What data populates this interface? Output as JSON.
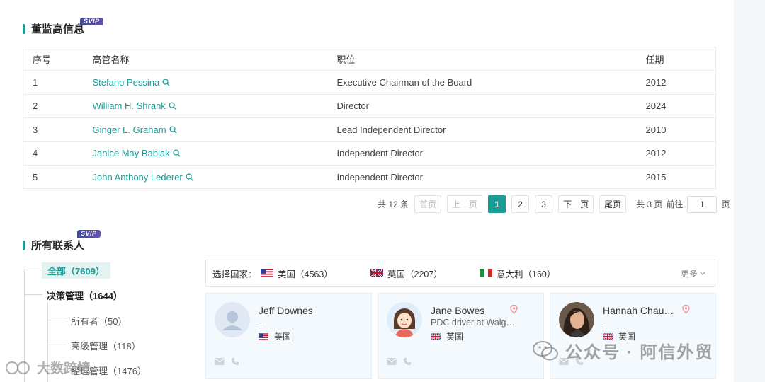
{
  "exec_section": {
    "title": "董监高信息",
    "badge": "SVIP",
    "columns": [
      "序号",
      "高管名称",
      "职位",
      "任期"
    ],
    "rows": [
      {
        "no": "1",
        "name": "Stefano Pessina",
        "position": "Executive Chairman of the Board",
        "term": "2012"
      },
      {
        "no": "2",
        "name": "William H. Shrank",
        "position": "Director",
        "term": "2024"
      },
      {
        "no": "3",
        "name": "Ginger L. Graham",
        "position": "Lead Independent Director",
        "term": "2010"
      },
      {
        "no": "4",
        "name": "Janice May Babiak",
        "position": "Independent Director",
        "term": "2012"
      },
      {
        "no": "5",
        "name": "John Anthony Lederer",
        "position": "Independent Director",
        "term": "2015"
      }
    ]
  },
  "pagination": {
    "total": "共 12 条",
    "first": "首页",
    "prev": "上一页",
    "pages": [
      "1",
      "2",
      "3"
    ],
    "current": "1",
    "next": "下一页",
    "last": "尾页",
    "page_count": "共 3 页",
    "goto": "前往",
    "goto_value": "1",
    "page_unit": "页"
  },
  "contacts_section": {
    "title": "所有联系人",
    "badge": "SVIP",
    "tree": {
      "all": "全部（7609）",
      "decision": "决策管理（1644）",
      "owner": "所有者（50）",
      "senior": "高级管理（118）",
      "manager": "经理管理（1476）"
    },
    "country_filter": {
      "label": "选择国家：",
      "countries": [
        {
          "name": "美国（4563）",
          "flag": "us-flag"
        },
        {
          "name": "英国（2207）",
          "flag": "uk-flag"
        },
        {
          "name": "意大利（160）",
          "flag": "italy-flag"
        }
      ],
      "more": "更多"
    },
    "cards": [
      {
        "name": "Jeff Downes",
        "role": "-",
        "country": "美国",
        "flag": "us-flag",
        "avatar": "placeholder-avatar"
      },
      {
        "name": "Jane Bowes",
        "role": "PDC driver at Walgreens",
        "country": "英国",
        "flag": "uk-flag",
        "avatar": "cartoon-woman-avatar"
      },
      {
        "name": "Hannah Chaudhry",
        "role": "-",
        "country": "英国",
        "flag": "uk-flag",
        "avatar": "photo-avatar"
      }
    ]
  },
  "watermarks": {
    "right": "公众号 · 阿信外贸",
    "left": "大数跨境"
  },
  "colors": {
    "accent": "#1a9c95",
    "svip_gradient_start": "#3b4a9e",
    "svip_gradient_end": "#6a4fb3",
    "card_bg": "#f4f9fd"
  }
}
